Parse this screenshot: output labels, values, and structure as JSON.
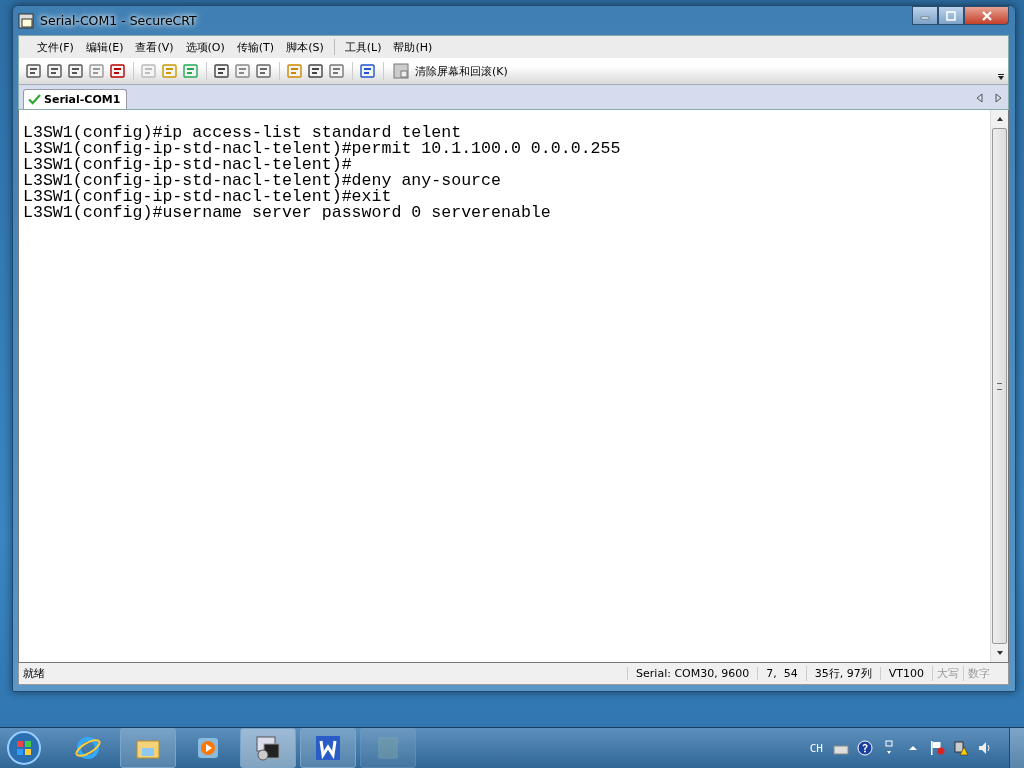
{
  "window": {
    "title": "Serial-COM1 - SecureCRT"
  },
  "menu": [
    {
      "label": "文件(F)"
    },
    {
      "label": "编辑(E)"
    },
    {
      "label": "查看(V)"
    },
    {
      "label": "选项(O)"
    },
    {
      "label": "传输(T)"
    },
    {
      "label": "脚本(S)"
    },
    {
      "label": "工具(L)"
    },
    {
      "label": "帮助(H)"
    }
  ],
  "toolbar": {
    "clear_button": "清除屏幕和回滚(K)"
  },
  "tabs": [
    {
      "label": "Serial-COM1",
      "selected": true
    }
  ],
  "terminal": {
    "lines": [
      "L3SW1(config)#ip access-list standard telent",
      "L3SW1(config-ip-std-nacl-telent)#permit 10.1.100.0 0.0.0.255",
      "L3SW1(config-ip-std-nacl-telent)#",
      "L3SW1(config-ip-std-nacl-telent)#deny any-source",
      "L3SW1(config-ip-std-nacl-telent)#exit",
      "L3SW1(config)#username server password 0 serverenable"
    ]
  },
  "status_bar": {
    "message": "就绪",
    "fields": [
      {
        "text": "Serial: COM30, 9600",
        "disabled": false
      },
      {
        "text": "7,  54",
        "disabled": false
      },
      {
        "text": "35行, 97列",
        "disabled": false
      },
      {
        "text": "VT100",
        "disabled": false
      },
      {
        "text": "大写",
        "disabled": true
      },
      {
        "text": "数字",
        "disabled": true
      }
    ]
  },
  "taskbar": {
    "tray_language": "CH"
  }
}
